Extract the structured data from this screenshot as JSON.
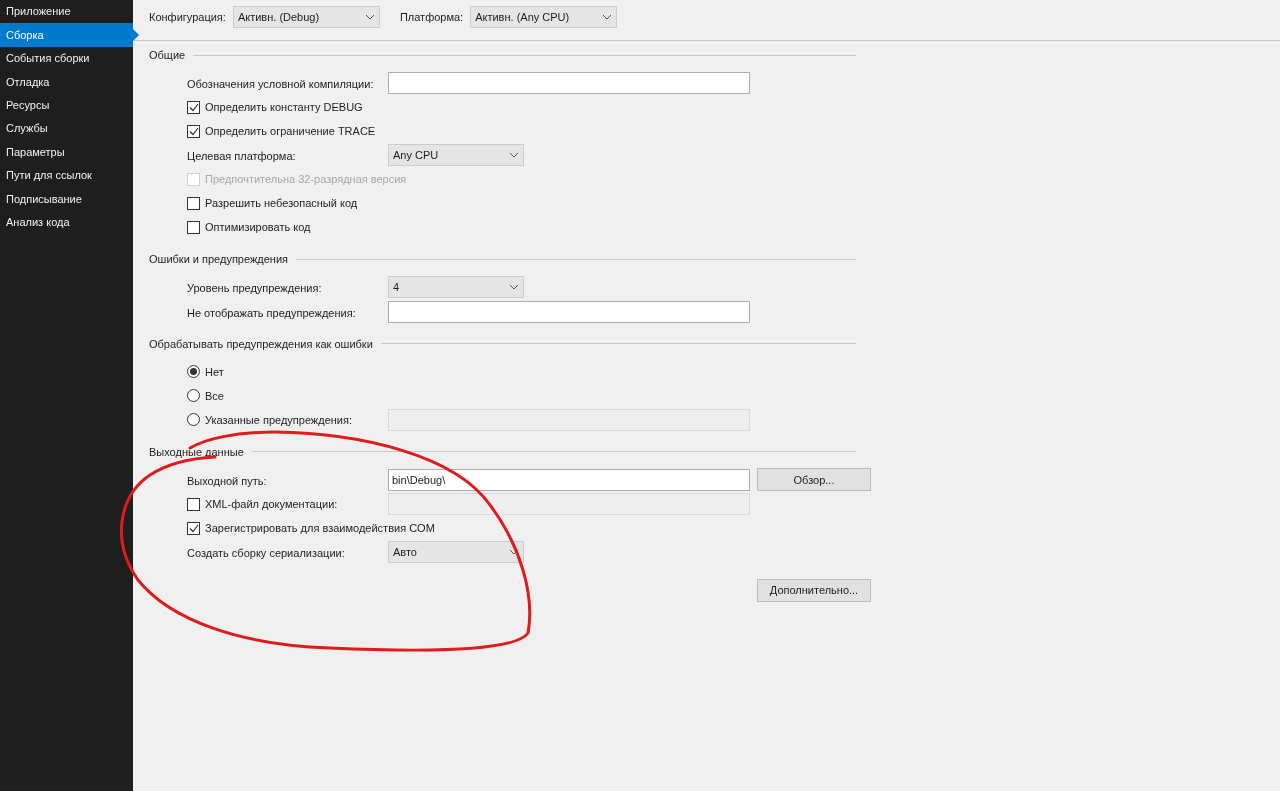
{
  "sidebar": {
    "items": [
      {
        "label": "Приложение",
        "selected": false
      },
      {
        "label": "Сборка",
        "selected": true
      },
      {
        "label": "События сборки",
        "selected": false
      },
      {
        "label": "Отладка",
        "selected": false
      },
      {
        "label": "Ресурсы",
        "selected": false
      },
      {
        "label": "Службы",
        "selected": false
      },
      {
        "label": "Параметры",
        "selected": false
      },
      {
        "label": "Пути для ссылок",
        "selected": false
      },
      {
        "label": "Подписывание",
        "selected": false
      },
      {
        "label": "Анализ кода",
        "selected": false
      }
    ]
  },
  "toolbar": [
    {
      "label": "Конфигурация:",
      "value": "Активн. (Debug)"
    },
    {
      "label": "Платформа:",
      "value": "Активн. (Any CPU)"
    }
  ],
  "sections": [
    {
      "title": "Общие",
      "rows": [
        {
          "kind": "field",
          "label": "Обозначения условной компиляции:",
          "value": "",
          "disabled": false
        },
        {
          "kind": "checkbox",
          "label": "Определить константу DEBUG",
          "checked": true,
          "disabled": false
        },
        {
          "kind": "checkbox",
          "label": "Определить ограничение TRACE",
          "checked": true,
          "disabled": false
        },
        {
          "kind": "dropdown",
          "label": "Целевая платформа:",
          "value": "Any CPU"
        },
        {
          "kind": "checkbox",
          "label": "Предпочтительна 32-разрядная версия",
          "checked": false,
          "disabled": true
        },
        {
          "kind": "checkbox",
          "label": "Разрешить небезопасный код",
          "checked": false,
          "disabled": false
        },
        {
          "kind": "checkbox",
          "label": "Оптимизировать код",
          "checked": false,
          "disabled": false
        }
      ]
    },
    {
      "title": "Ошибки и предупреждения",
      "rows": [
        {
          "kind": "dropdown",
          "label": "Уровень предупреждения:",
          "value": "4"
        },
        {
          "kind": "field",
          "label": "Не отображать предупреждения:",
          "value": "",
          "disabled": false
        }
      ]
    },
    {
      "title": "Обрабатывать предупреждения как ошибки",
      "rows": [
        {
          "kind": "radio",
          "label": "Нет",
          "selected": true
        },
        {
          "kind": "radio",
          "label": "Все",
          "selected": false
        },
        {
          "kind": "radio_field",
          "label": "Указанные предупреждения:",
          "selected": false
        }
      ]
    },
    {
      "title": "Выходные данные",
      "rows": [
        {
          "kind": "field",
          "label": "Выходной путь:",
          "value": "bin\\Debug\\",
          "disabled": false,
          "button": "Обзор..."
        },
        {
          "kind": "checkbox_field",
          "label": "XML-файл документации:",
          "checked": false,
          "disabled": false
        },
        {
          "kind": "checkbox",
          "label": "Зарегистрировать для взаимодействия COM",
          "checked": true,
          "disabled": false
        },
        {
          "kind": "dropdown",
          "label": "Создать сборку сериализации:",
          "value": "Авто"
        },
        {
          "kind": "button",
          "label": "Дополнительно..."
        }
      ]
    }
  ]
}
